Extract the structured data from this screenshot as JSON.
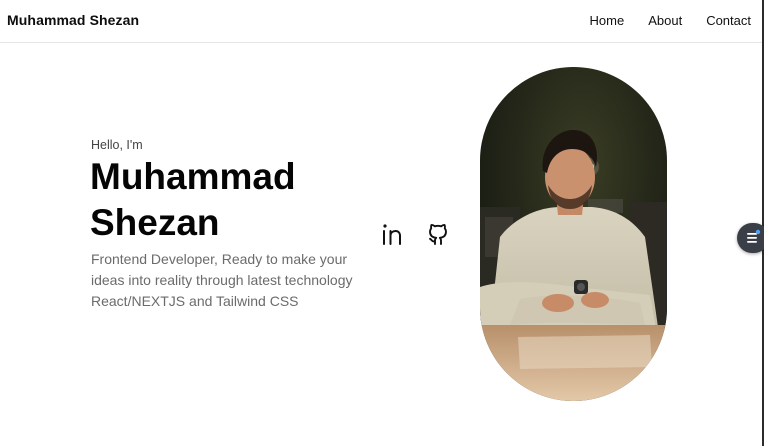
{
  "nav": {
    "brand": "Muhammad Shezan",
    "links": [
      "Home",
      "About",
      "Contact"
    ]
  },
  "hero": {
    "greeting": "Hello, I'm",
    "name_line1": "Muhammad",
    "name_line2": "Shezan",
    "tagline": "Frontend Developer, Ready to make your ideas into reality through latest technology React/NEXTJS and Tailwind CSS"
  },
  "socials": [
    {
      "icon": "linkedin-icon"
    },
    {
      "icon": "github-icon"
    }
  ],
  "colors": {
    "text": "#050505",
    "muted": "#6b6b6b",
    "fab": "#3a3f47",
    "fab_dot": "#4aa3ff"
  }
}
